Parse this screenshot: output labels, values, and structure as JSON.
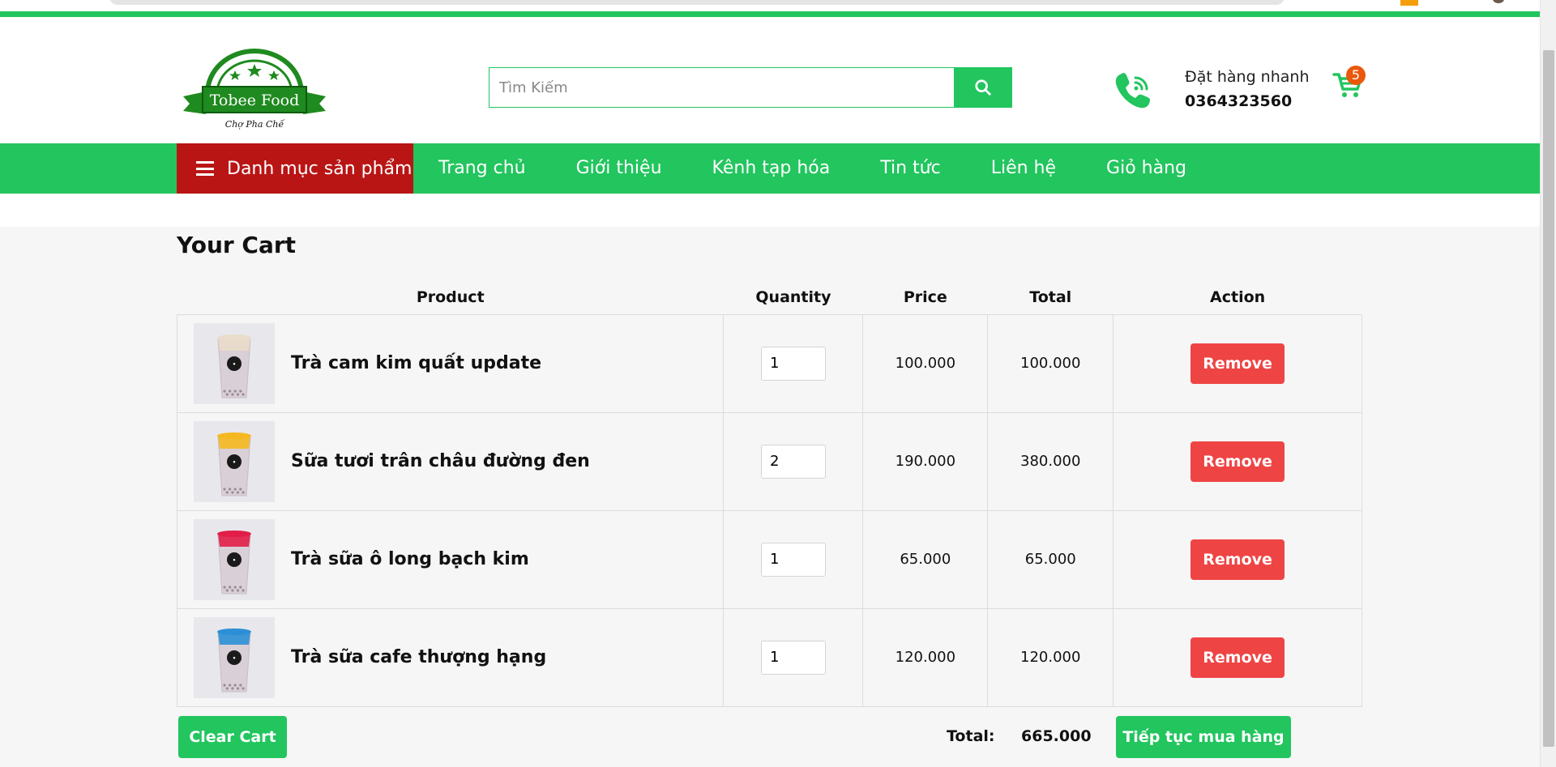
{
  "brand": {
    "logo_text": "Tobee Food",
    "logo_subtext": "Chợ Pha Chế"
  },
  "search": {
    "placeholder": "Tìm Kiếm"
  },
  "contact": {
    "label": "Đặt hàng nhanh",
    "phone": "0364323560"
  },
  "cart_badge": {
    "count": "5"
  },
  "nav": {
    "category_label": "Danh mục sản phẩm",
    "items": [
      {
        "label": "Trang chủ"
      },
      {
        "label": "Giới thiệu"
      },
      {
        "label": "Kênh tạp hóa"
      },
      {
        "label": "Tin tức"
      },
      {
        "label": "Liên hệ"
      },
      {
        "label": "Giỏ hàng"
      }
    ]
  },
  "cart": {
    "title": "Your Cart",
    "headers": {
      "product": "Product",
      "quantity": "Quantity",
      "price": "Price",
      "total": "Total",
      "action": "Action"
    },
    "items": [
      {
        "name": "Trà cam kim quất update",
        "quantity": "1",
        "price": "100.000",
        "total": "100.000",
        "remove_label": "Remove",
        "topping_color": "#e9dccb"
      },
      {
        "name": "Sữa tươi trân châu đường đen",
        "quantity": "2",
        "price": "190.000",
        "total": "380.000",
        "remove_label": "Remove",
        "topping_color": "#f5b820"
      },
      {
        "name": "Trà sữa ô long bạch kim",
        "quantity": "1",
        "price": "65.000",
        "total": "65.000",
        "remove_label": "Remove",
        "topping_color": "#e11d48"
      },
      {
        "name": "Trà sữa cafe thượng hạng",
        "quantity": "1",
        "price": "120.000",
        "total": "120.000",
        "remove_label": "Remove",
        "topping_color": "#2b8fd6"
      }
    ],
    "clear_label": "Clear Cart",
    "total_label": "Total:",
    "total_value": "665.000",
    "continue_label": "Tiếp tục mua hàng"
  },
  "colors": {
    "primary_green": "#22c55e",
    "category_red": "#b91515",
    "remove_red": "#ef4444",
    "badge_orange": "#ea580c"
  }
}
